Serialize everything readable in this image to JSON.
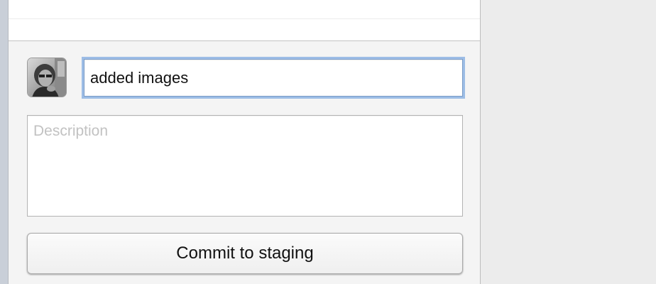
{
  "commit_panel": {
    "summary": {
      "value": "added images"
    },
    "description": {
      "placeholder": "Description",
      "value": ""
    },
    "commit_button_label": "Commit to staging",
    "avatar_icon": "user-photo-icon"
  },
  "colors": {
    "focus_ring": "#9dbde6",
    "panel_background": "#f4f4f4",
    "window_background": "#ececec"
  }
}
